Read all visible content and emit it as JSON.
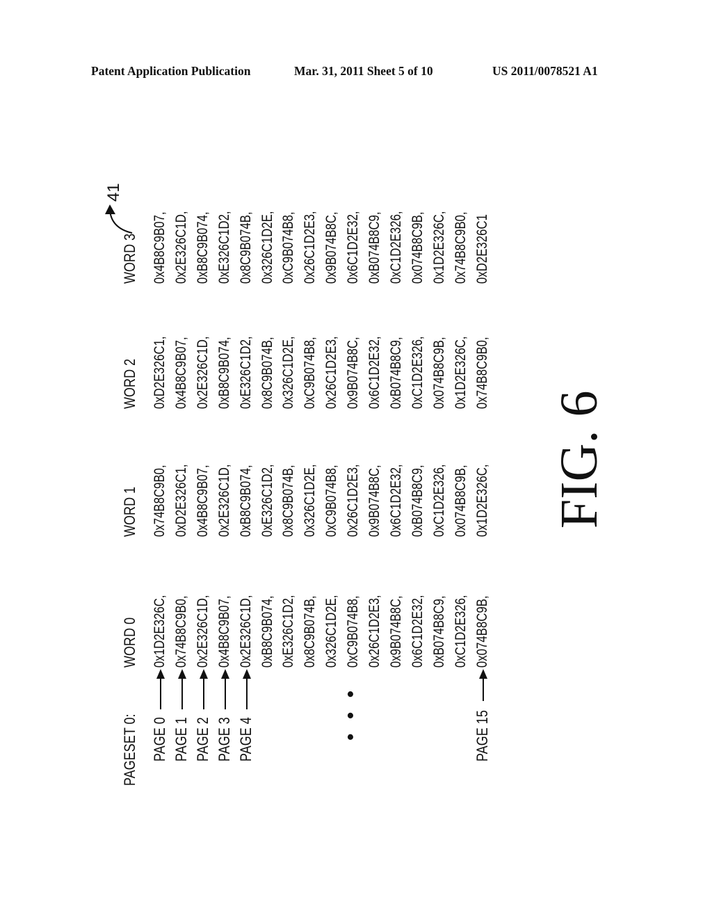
{
  "header": {
    "left": "Patent Application Publication",
    "middle": "Mar. 31, 2011  Sheet 5 of 10",
    "right": "US 2011/0078521 A1"
  },
  "figure": {
    "reference_numeral": "41",
    "caption": "FIG. 6",
    "pageset_label": "PAGESET 0:",
    "ellipsis": "• • •",
    "page_labels": [
      "PAGE 0",
      "PAGE 1",
      "PAGE 2",
      "PAGE 3",
      "PAGE 4",
      "PAGE 15"
    ],
    "columns": [
      "WORD 0",
      "WORD 1",
      "WORD 2",
      "WORD 3"
    ],
    "rows": [
      [
        "0x1D2E326C,",
        "0x74B8C9B0,",
        "0xD2E326C1,",
        "0x4B8C9B07,"
      ],
      [
        "0x74B8C9B0,",
        "0xD2E326C1,",
        "0x4B8C9B07,",
        "0x2E326C1D,"
      ],
      [
        "0x2E326C1D,",
        "0x4B8C9B07,",
        "0x2E326C1D,",
        "0xB8C9B074,"
      ],
      [
        "0x4B8C9B07,",
        "0x2E326C1D,",
        "0xB8C9B074,",
        "0xE326C1D2,"
      ],
      [
        "0x2E326C1D,",
        "0xB8C9B074,",
        "0xE326C1D2,",
        "0x8C9B074B,"
      ],
      [
        "0xB8C9B074,",
        "0xE326C1D2,",
        "0x8C9B074B,",
        "0x326C1D2E,"
      ],
      [
        "0xE326C1D2,",
        "0x8C9B074B,",
        "0x326C1D2E,",
        "0xC9B074B8,"
      ],
      [
        "0x8C9B074B,",
        "0x326C1D2E,",
        "0xC9B074B8,",
        "0x26C1D2E3,"
      ],
      [
        "0x326C1D2E,",
        "0xC9B074B8,",
        "0x26C1D2E3,",
        "0x9B074B8C,"
      ],
      [
        "0xC9B074B8,",
        "0x26C1D2E3,",
        "0x9B074B8C,",
        "0x6C1D2E32,"
      ],
      [
        "0x26C1D2E3,",
        "0x9B074B8C,",
        "0x6C1D2E32,",
        "0xB074B8C9,"
      ],
      [
        "0x9B074B8C,",
        "0x6C1D2E32,",
        "0xB074B8C9,",
        "0xC1D2E326,"
      ],
      [
        "0x6C1D2E32,",
        "0xB074B8C9,",
        "0xC1D2E326,",
        "0x074B8C9B,"
      ],
      [
        "0xB074B8C9,",
        "0xC1D2E326,",
        "0x074B8C9B,",
        "0x1D2E326C,"
      ],
      [
        "0xC1D2E326,",
        "0x074B8C9B,",
        "0x1D2E326C,",
        "0x74B8C9B0,"
      ],
      [
        "0x074B8C9B,",
        "0x1D2E326C,",
        "0x74B8C9B0,",
        "0xD2E326C1"
      ]
    ]
  }
}
